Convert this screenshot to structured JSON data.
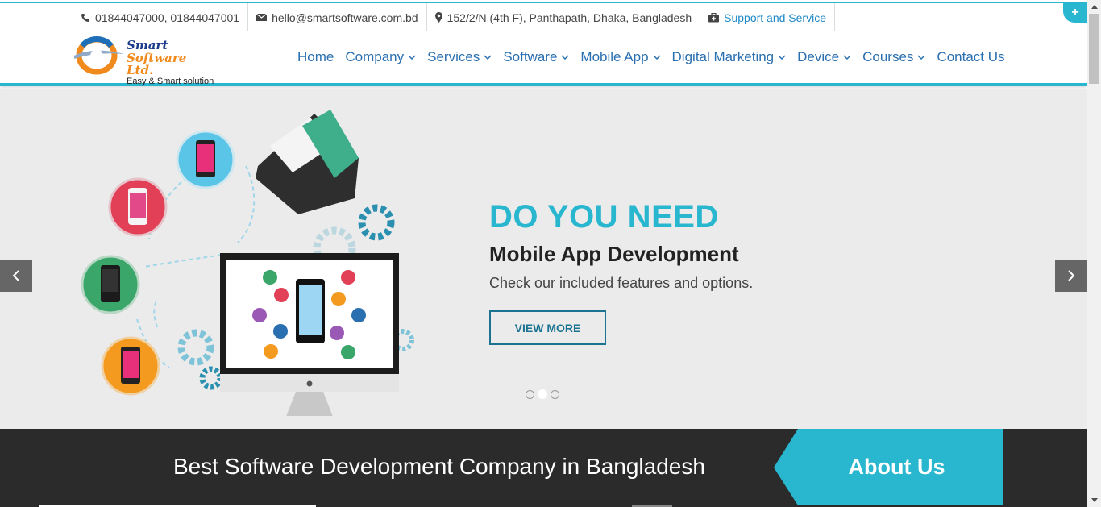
{
  "topbar": {
    "phone": "01844047000, 01844047001",
    "email": "hello@smartsoftware.com.bd",
    "address": "152/2/N (4th F), Panthapath, Dhaka, Bangladesh",
    "support_link": "Support and Service",
    "corner_button": "+"
  },
  "logo": {
    "line1": "Smart",
    "line2": "Software Ltd.",
    "tagline": "Easy & Smart solution"
  },
  "nav": {
    "items": [
      {
        "label": "Home",
        "dropdown": false
      },
      {
        "label": "Company",
        "dropdown": true
      },
      {
        "label": "Services",
        "dropdown": true
      },
      {
        "label": "Software",
        "dropdown": true
      },
      {
        "label": "Mobile App",
        "dropdown": true
      },
      {
        "label": "Digital Marketing",
        "dropdown": true
      },
      {
        "label": "Device",
        "dropdown": true
      },
      {
        "label": "Courses",
        "dropdown": true
      },
      {
        "label": "Contact Us",
        "dropdown": false
      }
    ]
  },
  "hero": {
    "heading": "DO YOU NEED",
    "subheading": "Mobile App Development",
    "text": "Check our included features and options.",
    "button": "VIEW MORE",
    "slides_count": 3,
    "active_slide": 2
  },
  "band": {
    "title": "Best Software Development Company in Bangladesh",
    "about_label": "About Us"
  },
  "colors": {
    "accent": "#29b6cf",
    "link": "#2a6fb0",
    "dark": "#2b2b2b",
    "button_border": "#1b7391"
  }
}
